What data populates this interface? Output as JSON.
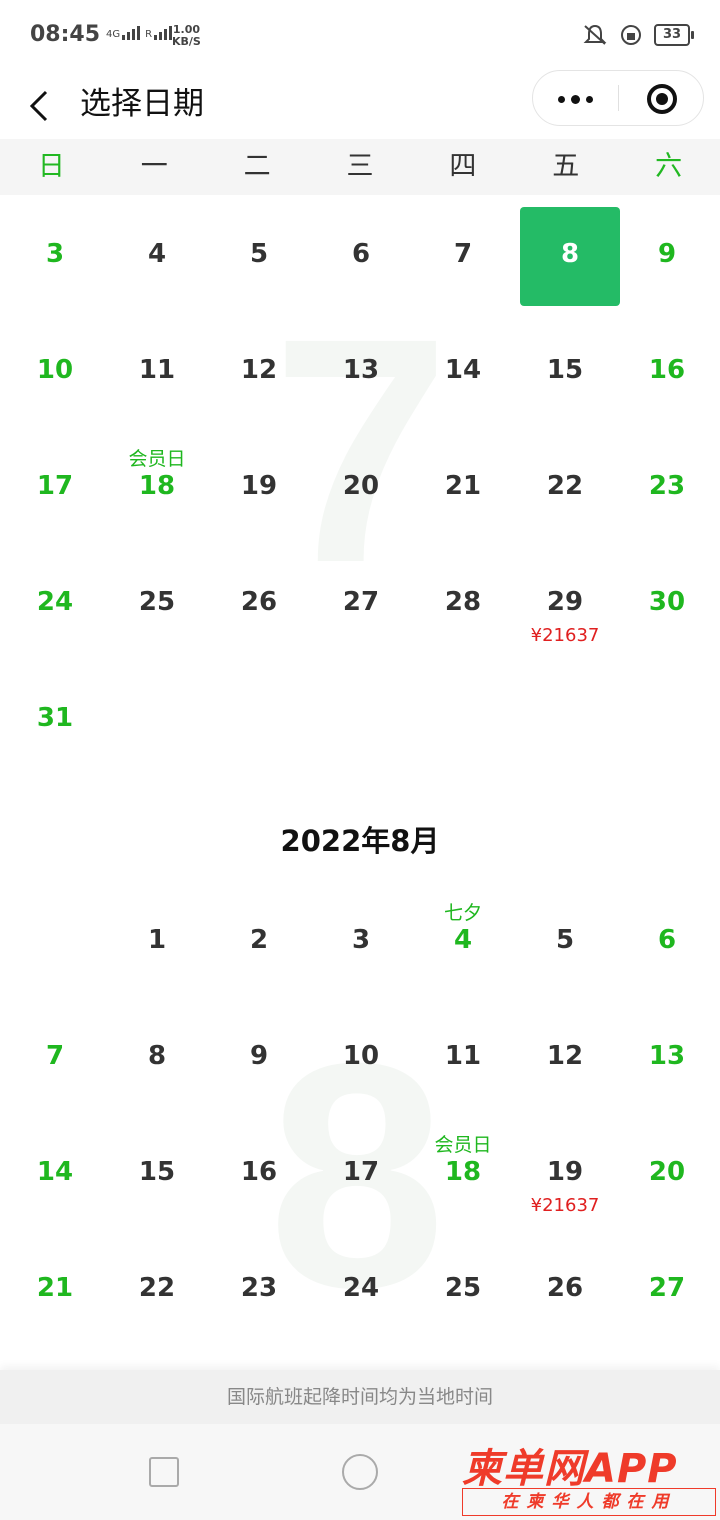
{
  "status_bar": {
    "time": "08:45",
    "network": "4G",
    "roaming": "R",
    "speed_value": "1.00",
    "speed_unit": "KB/S",
    "battery": "33"
  },
  "nav": {
    "title": "选择日期"
  },
  "weekdays": [
    "日",
    "一",
    "二",
    "三",
    "四",
    "五",
    "六"
  ],
  "months": [
    {
      "title": "",
      "watermark": "7",
      "weeks": [
        [
          {
            "day": "3",
            "green": true
          },
          {
            "day": "4"
          },
          {
            "day": "5"
          },
          {
            "day": "6"
          },
          {
            "day": "7"
          },
          {
            "day": "8",
            "selected": true
          },
          {
            "day": "9",
            "green": true
          }
        ],
        [
          {
            "day": "10",
            "green": true
          },
          {
            "day": "11"
          },
          {
            "day": "12"
          },
          {
            "day": "13"
          },
          {
            "day": "14"
          },
          {
            "day": "15"
          },
          {
            "day": "16",
            "green": true
          }
        ],
        [
          {
            "day": "17",
            "green": true
          },
          {
            "day": "18",
            "green": true,
            "tag": "会员日"
          },
          {
            "day": "19"
          },
          {
            "day": "20"
          },
          {
            "day": "21"
          },
          {
            "day": "22"
          },
          {
            "day": "23",
            "green": true
          }
        ],
        [
          {
            "day": "24",
            "green": true
          },
          {
            "day": "25"
          },
          {
            "day": "26"
          },
          {
            "day": "27"
          },
          {
            "day": "28"
          },
          {
            "day": "29",
            "price": "¥21637"
          },
          {
            "day": "30",
            "green": true
          }
        ],
        [
          {
            "day": "31",
            "green": true
          },
          null,
          null,
          null,
          null,
          null,
          null
        ]
      ]
    },
    {
      "title": "2022年8月",
      "watermark": "8",
      "weeks": [
        [
          null,
          {
            "day": "1"
          },
          {
            "day": "2"
          },
          {
            "day": "3"
          },
          {
            "day": "4",
            "green": true,
            "tag": "七夕"
          },
          {
            "day": "5"
          },
          {
            "day": "6",
            "green": true
          }
        ],
        [
          {
            "day": "7",
            "green": true
          },
          {
            "day": "8"
          },
          {
            "day": "9"
          },
          {
            "day": "10"
          },
          {
            "day": "11"
          },
          {
            "day": "12"
          },
          {
            "day": "13",
            "green": true
          }
        ],
        [
          {
            "day": "14",
            "green": true
          },
          {
            "day": "15"
          },
          {
            "day": "16"
          },
          {
            "day": "17"
          },
          {
            "day": "18",
            "green": true,
            "tag": "会员日"
          },
          {
            "day": "19",
            "price": "¥21637"
          },
          {
            "day": "20",
            "green": true
          }
        ],
        [
          {
            "day": "21",
            "green": true
          },
          {
            "day": "22"
          },
          {
            "day": "23"
          },
          {
            "day": "24"
          },
          {
            "day": "25"
          },
          {
            "day": "26"
          },
          {
            "day": "27",
            "green": true
          }
        ]
      ]
    }
  ],
  "notice": "国际航班起降时间均为当地时间",
  "watermark_logo": {
    "main": "柬单网APP",
    "sub": "在柬华人都在用"
  },
  "colors": {
    "accent_green": "#24bb66",
    "weekend_green": "#1fb71f",
    "price_red": "#e02020"
  }
}
